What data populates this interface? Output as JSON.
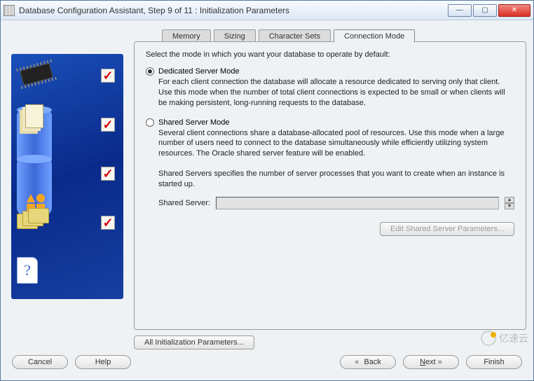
{
  "window": {
    "title": "Database Configuration Assistant, Step 9 of 11 : Initialization Parameters"
  },
  "tabs": {
    "memory": "Memory",
    "sizing": "Sizing",
    "charsets": "Character Sets",
    "connmode": "Connection Mode"
  },
  "intro": "Select the mode in which you want your database to operate by default:",
  "mode1": {
    "label": "Dedicated Server Mode",
    "desc": "For each client connection the database will allocate a resource dedicated to serving only that client.  Use this mode when the number of total client connections is expected to be small or when clients will be making persistent, long-running requests to the database."
  },
  "mode2": {
    "label": "Shared Server Mode",
    "desc": "Several client connections share a database-allocated pool of resources.  Use this mode when a large number of users need to connect to the database simultaneously while efficiently utilizing system resources.  The Oracle shared server feature will be enabled."
  },
  "shared_note": "Shared Servers specifies the number of server processes that you want to create when an instance is started up.",
  "shared_server_label": "Shared Server:",
  "shared_server_value": "",
  "edit_params_btn": "Edit Shared Server Parameters...",
  "all_params_btn": "All Initialization Parameters...",
  "footer": {
    "cancel": "Cancel",
    "help": "Help",
    "back": "Back",
    "next": "Next",
    "finish": "Finish"
  },
  "watermark": "亿速云"
}
